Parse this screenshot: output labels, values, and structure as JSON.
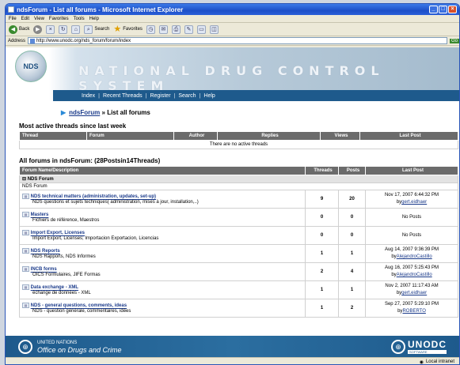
{
  "window": {
    "title": "ndsForum - List all forums - Microsoft Internet Explorer"
  },
  "menubar": [
    "File",
    "Edit",
    "View",
    "Favorites",
    "Tools",
    "Help"
  ],
  "toolbar": {
    "back": "Back",
    "search": "Search",
    "favorites": "Favorites"
  },
  "addressbar": {
    "label": "Address",
    "url": "http://www.unodc.org/nds_forum/forum/index",
    "go": "Go"
  },
  "site": {
    "logo": "NDS",
    "banner_title": "NATIONAL DRUG CONTROL SYSTEM",
    "nav": [
      "Index",
      "Recent Threads",
      "Register",
      "Search",
      "Help"
    ]
  },
  "breadcrumb": {
    "link": "ndsForum",
    "sep": "»",
    "current": "List all forums"
  },
  "active_threads": {
    "title": "Most active threads since last week",
    "columns": [
      "Thread",
      "Forum",
      "Author",
      "Replies",
      "Views",
      "Last Post"
    ],
    "empty_text": "There are no active threads"
  },
  "forums": {
    "title": "All forums in ndsForum: (28Postsin14Threads)",
    "columns": [
      "Forum Name/Description",
      "Threads",
      "Posts",
      "Last Post"
    ],
    "group_name": "NDS Forum",
    "group_desc": "NDS Forum",
    "rows": [
      {
        "name": "NDS technical matters (administration, updates, set-up)",
        "desc": "NDS questions et sujets techniques( administration, mises à jour, installation,..)",
        "threads": "9",
        "posts": "20",
        "last": "Nov 17, 2007 6:44:32 PM",
        "by": "by",
        "user": "gert.eidhaer"
      },
      {
        "name": "Masters",
        "desc": "Fichiers de référence, Maestros",
        "threads": "0",
        "posts": "0",
        "last": "No Posts",
        "by": "",
        "user": ""
      },
      {
        "name": "Import Export, Licenses",
        "desc": "Import Export, Licenses; Importacion Exportacion, Licencias",
        "threads": "0",
        "posts": "0",
        "last": "No Posts",
        "by": "",
        "user": ""
      },
      {
        "name": "NDS Reports",
        "desc": "NDS Rapports, NDS Informes",
        "threads": "1",
        "posts": "1",
        "last": "Aug 14, 2007 9:36:39 PM",
        "by": "by",
        "user": "AlejandroCastillo"
      },
      {
        "name": "INCB forms",
        "desc": "OICS Formulaires, JIFE Formas",
        "threads": "2",
        "posts": "4",
        "last": "Aug 16, 2007 5:25:43 PM",
        "by": "by",
        "user": "AlejandroCastillo"
      },
      {
        "name": "Data exchange - XML",
        "desc": "échange de données - XML",
        "threads": "1",
        "posts": "1",
        "last": "Nov 2, 2007 11:17:43 AM",
        "by": "by",
        "user": "gert.eidhaer"
      },
      {
        "name": "NDS - general questions, comments, ideas",
        "desc": "NDS - question générale, commentaires, idées",
        "threads": "1",
        "posts": "2",
        "last": "Sep 27, 2007 5:29:10 PM",
        "by": "by",
        "user": "ROBERTO"
      }
    ]
  },
  "footer": {
    "un_line1": "UNITED NATIONS",
    "un_line2": "Office on Drugs and Crime",
    "unodc": "UNODC",
    "software": "SOFTWARE"
  },
  "statusbar": {
    "zone": "Local intranet"
  }
}
